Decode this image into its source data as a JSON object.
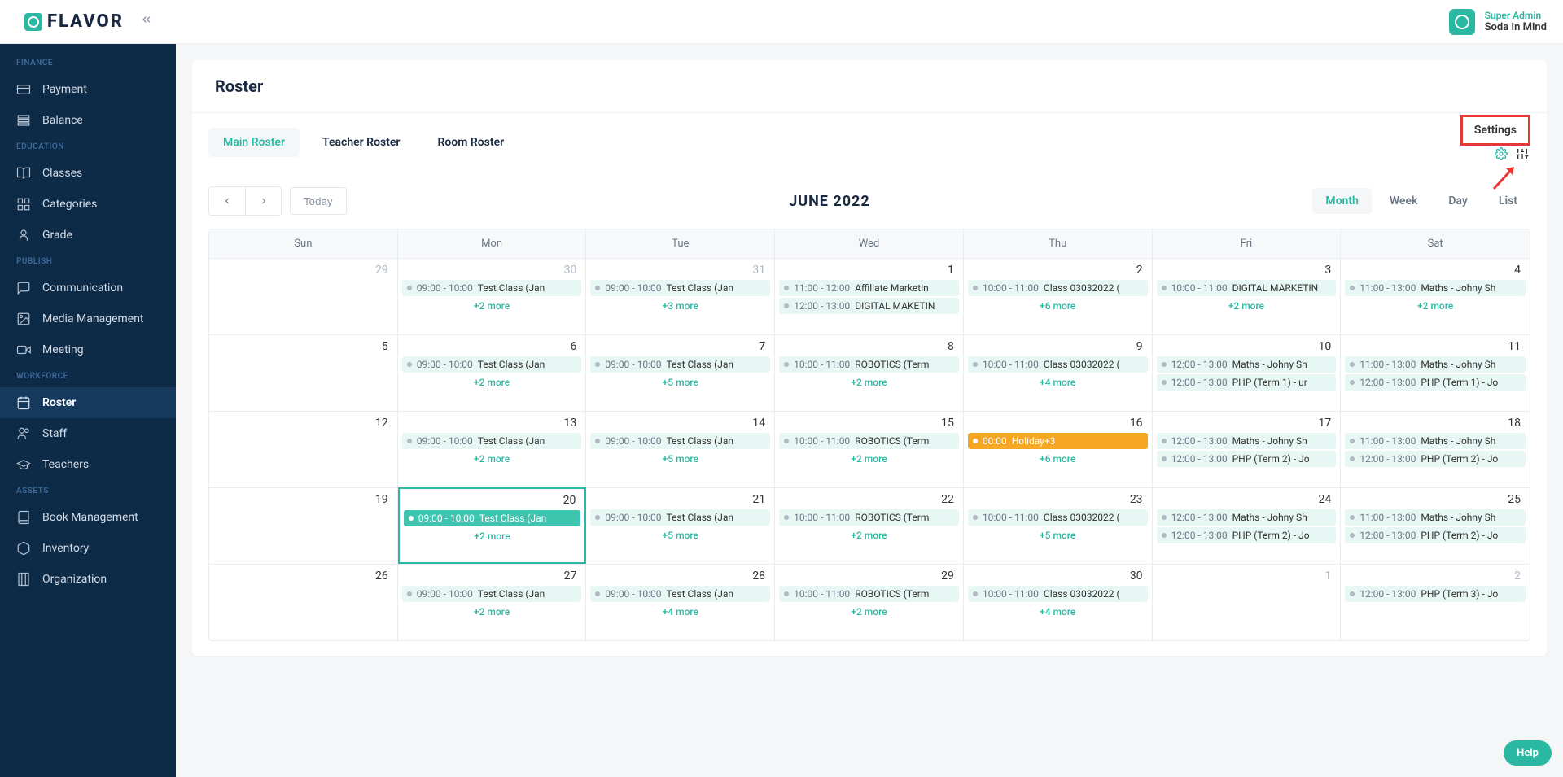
{
  "brand": "FLAVOR",
  "user": {
    "role": "Super Admin",
    "name": "Soda In Mind"
  },
  "sidebar": [
    {
      "section": "FINANCE"
    },
    {
      "icon": "credit-card-icon",
      "label": "Payment"
    },
    {
      "icon": "bars-icon",
      "label": "Balance"
    },
    {
      "section": "EDUCATION"
    },
    {
      "icon": "book-open-icon",
      "label": "Classes"
    },
    {
      "icon": "grid-icon",
      "label": "Categories"
    },
    {
      "icon": "grade-icon",
      "label": "Grade"
    },
    {
      "section": "PUBLISH"
    },
    {
      "icon": "chat-icon",
      "label": "Communication"
    },
    {
      "icon": "media-icon",
      "label": "Media Management"
    },
    {
      "icon": "video-icon",
      "label": "Meeting"
    },
    {
      "section": "WORKFORCE"
    },
    {
      "icon": "calendar-icon",
      "label": "Roster",
      "active": true
    },
    {
      "icon": "people-icon",
      "label": "Staff"
    },
    {
      "icon": "cap-icon",
      "label": "Teachers"
    },
    {
      "section": "ASSETS"
    },
    {
      "icon": "book-icon",
      "label": "Book Management"
    },
    {
      "icon": "box-icon",
      "label": "Inventory"
    },
    {
      "icon": "building-icon",
      "label": "Organization"
    }
  ],
  "page_title": "Roster",
  "tabs": [
    {
      "label": "Main Roster",
      "active": true
    },
    {
      "label": "Teacher Roster"
    },
    {
      "label": "Room Roster"
    }
  ],
  "settings_label": "Settings",
  "today_label": "Today",
  "cal_title": "JUNE 2022",
  "views": [
    {
      "label": "Month",
      "active": true
    },
    {
      "label": "Week"
    },
    {
      "label": "Day"
    },
    {
      "label": "List"
    }
  ],
  "day_headers": [
    "Sun",
    "Mon",
    "Tue",
    "Wed",
    "Thu",
    "Fri",
    "Sat"
  ],
  "cells": [
    {
      "d": "29",
      "dim": true,
      "events": [],
      "more": null
    },
    {
      "d": "30",
      "dim": true,
      "events": [
        {
          "t": "09:00 - 10:00",
          "n": "Test Class (Jan"
        }
      ],
      "more": "+2 more"
    },
    {
      "d": "31",
      "dim": true,
      "events": [
        {
          "t": "09:00 - 10:00",
          "n": "Test Class (Jan"
        }
      ],
      "more": "+3 more"
    },
    {
      "d": "1",
      "events": [
        {
          "t": "11:00 - 12:00",
          "n": "Affiliate Marketin"
        },
        {
          "t": "12:00 - 13:00",
          "n": "DIGITAL MAKETIN"
        }
      ],
      "more": null
    },
    {
      "d": "2",
      "events": [
        {
          "t": "10:00 - 11:00",
          "n": "Class 03032022 ("
        }
      ],
      "more": "+6 more"
    },
    {
      "d": "3",
      "events": [
        {
          "t": "10:00 - 11:00",
          "n": "DIGITAL MARKETIN"
        }
      ],
      "more": "+2 more"
    },
    {
      "d": "4",
      "events": [
        {
          "t": "11:00 - 13:00",
          "n": "Maths - Johny Sh"
        }
      ],
      "more": "+2 more"
    },
    {
      "d": "5",
      "events": [],
      "more": null
    },
    {
      "d": "6",
      "events": [
        {
          "t": "09:00 - 10:00",
          "n": "Test Class (Jan"
        }
      ],
      "more": "+2 more"
    },
    {
      "d": "7",
      "events": [
        {
          "t": "09:00 - 10:00",
          "n": "Test Class (Jan"
        }
      ],
      "more": "+5 more"
    },
    {
      "d": "8",
      "events": [
        {
          "t": "10:00 - 11:00",
          "n": "ROBOTICS (Term"
        }
      ],
      "more": "+2 more"
    },
    {
      "d": "9",
      "events": [
        {
          "t": "10:00 - 11:00",
          "n": "Class 03032022 ("
        }
      ],
      "more": "+4 more"
    },
    {
      "d": "10",
      "events": [
        {
          "t": "12:00 - 13:00",
          "n": "Maths - Johny Sh"
        },
        {
          "t": "12:00 - 13:00",
          "n": "PHP (Term 1) - ur"
        }
      ],
      "more": null
    },
    {
      "d": "11",
      "events": [
        {
          "t": "11:00 - 13:00",
          "n": "Maths - Johny Sh"
        },
        {
          "t": "12:00 - 13:00",
          "n": "PHP (Term 1) - Jo"
        }
      ],
      "more": null
    },
    {
      "d": "12",
      "events": [],
      "more": null
    },
    {
      "d": "13",
      "events": [
        {
          "t": "09:00 - 10:00",
          "n": "Test Class (Jan"
        }
      ],
      "more": "+2 more"
    },
    {
      "d": "14",
      "events": [
        {
          "t": "09:00 - 10:00",
          "n": "Test Class (Jan"
        }
      ],
      "more": "+5 more"
    },
    {
      "d": "15",
      "events": [
        {
          "t": "10:00 - 11:00",
          "n": "ROBOTICS (Term"
        }
      ],
      "more": "+2 more"
    },
    {
      "d": "16",
      "events": [
        {
          "t": "00:00",
          "n": "Holiday+3",
          "style": "orange-solid"
        }
      ],
      "more": "+6 more"
    },
    {
      "d": "17",
      "events": [
        {
          "t": "12:00 - 13:00",
          "n": "Maths - Johny Sh"
        },
        {
          "t": "12:00 - 13:00",
          "n": "PHP (Term 2) - Jo"
        }
      ],
      "more": null
    },
    {
      "d": "18",
      "events": [
        {
          "t": "11:00 - 13:00",
          "n": "Maths - Johny Sh"
        },
        {
          "t": "12:00 - 13:00",
          "n": "PHP (Term 2) - Jo"
        }
      ],
      "more": null
    },
    {
      "d": "19",
      "events": [],
      "more": null
    },
    {
      "d": "20",
      "today": true,
      "events": [
        {
          "t": "09:00 - 10:00",
          "n": "Test Class (Jan",
          "style": "teal-solid"
        }
      ],
      "more": "+2 more"
    },
    {
      "d": "21",
      "events": [
        {
          "t": "09:00 - 10:00",
          "n": "Test Class (Jan"
        }
      ],
      "more": "+5 more"
    },
    {
      "d": "22",
      "events": [
        {
          "t": "10:00 - 11:00",
          "n": "ROBOTICS (Term"
        }
      ],
      "more": "+2 more"
    },
    {
      "d": "23",
      "events": [
        {
          "t": "10:00 - 11:00",
          "n": "Class 03032022 ("
        }
      ],
      "more": "+5 more"
    },
    {
      "d": "24",
      "events": [
        {
          "t": "12:00 - 13:00",
          "n": "Maths - Johny Sh"
        },
        {
          "t": "12:00 - 13:00",
          "n": "PHP (Term 2) - Jo"
        }
      ],
      "more": null
    },
    {
      "d": "25",
      "events": [
        {
          "t": "11:00 - 13:00",
          "n": "Maths - Johny Sh"
        },
        {
          "t": "12:00 - 13:00",
          "n": "PHP (Term 2) - Jo"
        }
      ],
      "more": null
    },
    {
      "d": "26",
      "events": [],
      "more": null
    },
    {
      "d": "27",
      "events": [
        {
          "t": "09:00 - 10:00",
          "n": "Test Class (Jan"
        }
      ],
      "more": "+2 more"
    },
    {
      "d": "28",
      "events": [
        {
          "t": "09:00 - 10:00",
          "n": "Test Class (Jan"
        }
      ],
      "more": "+4 more"
    },
    {
      "d": "29",
      "events": [
        {
          "t": "10:00 - 11:00",
          "n": "ROBOTICS (Term"
        }
      ],
      "more": "+2 more"
    },
    {
      "d": "30",
      "events": [
        {
          "t": "10:00 - 11:00",
          "n": "Class 03032022 ("
        }
      ],
      "more": "+4 more"
    },
    {
      "d": "1",
      "dim": true,
      "events": [],
      "more": null
    },
    {
      "d": "2",
      "dim": true,
      "events": [
        {
          "t": "12:00 - 13:00",
          "n": "PHP (Term 3) - Jo"
        }
      ],
      "more": null
    }
  ],
  "help_label": "Help"
}
